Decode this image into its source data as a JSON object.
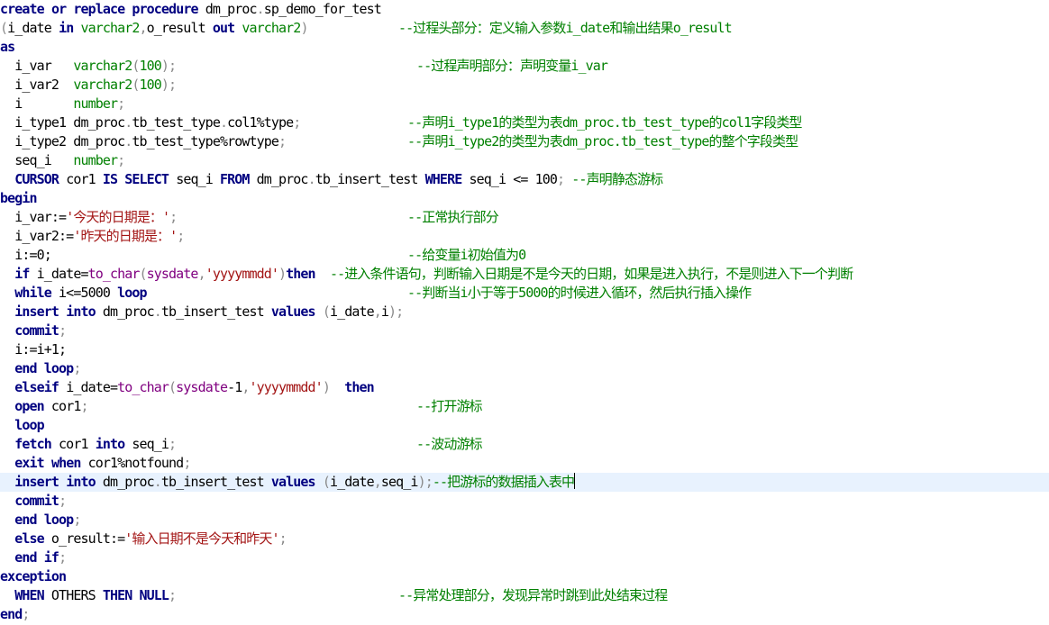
{
  "colors": {
    "keyword": "#000080",
    "type": "#008000",
    "string": "#a31515",
    "comment": "#008000",
    "punct": "#8a8a8a",
    "function": "#800080",
    "identifier": "#000000",
    "current_line": "#e8f2fe"
  },
  "editor": {
    "lines": [
      {
        "segs": [
          [
            "kw",
            "create"
          ],
          [
            "id",
            " "
          ],
          [
            "kw",
            "or"
          ],
          [
            "id",
            " "
          ],
          [
            "kw",
            "replace"
          ],
          [
            "id",
            " "
          ],
          [
            "kw",
            "procedure"
          ],
          [
            "id",
            " dm_proc"
          ],
          [
            "p",
            "."
          ],
          [
            "id",
            "sp_demo_for_test"
          ]
        ]
      },
      {
        "segs": [
          [
            "p",
            "("
          ],
          [
            "id",
            "i_date "
          ],
          [
            "kw",
            "in"
          ],
          [
            "id",
            " "
          ],
          [
            "ty",
            "varchar2"
          ],
          [
            "p",
            ","
          ],
          [
            "id",
            "o_result "
          ],
          [
            "kw",
            "out"
          ],
          [
            "id",
            " "
          ],
          [
            "ty",
            "varchar2"
          ],
          [
            "p",
            ")"
          ]
        ],
        "comment": "--过程头部分：定义输入参数i_date和输出结果o_result"
      },
      {
        "segs": [
          [
            "kw",
            "as"
          ]
        ]
      },
      {
        "segs": [
          [
            "id",
            "  i_var   "
          ],
          [
            "ty",
            "varchar2"
          ],
          [
            "p",
            "("
          ],
          [
            "ty",
            "100"
          ],
          [
            "p",
            ");"
          ]
        ],
        "comment": "--过程声明部分：声明变量i_var"
      },
      {
        "segs": [
          [
            "id",
            "  i_var2  "
          ],
          [
            "ty",
            "varchar2"
          ],
          [
            "p",
            "("
          ],
          [
            "ty",
            "100"
          ],
          [
            "p",
            ");"
          ]
        ]
      },
      {
        "segs": [
          [
            "id",
            "  i       "
          ],
          [
            "ty",
            "number"
          ],
          [
            "p",
            ";"
          ]
        ]
      },
      {
        "segs": [
          [
            "id",
            "  i_type1 dm_proc"
          ],
          [
            "p",
            "."
          ],
          [
            "id",
            "tb_test_type"
          ],
          [
            "p",
            "."
          ],
          [
            "id",
            "col1%type"
          ],
          [
            "p",
            ";"
          ]
        ],
        "comment": "--声明i_type1的类型为表dm_proc.tb_test_type的col1字段类型"
      },
      {
        "segs": [
          [
            "id",
            "  i_type2 dm_proc"
          ],
          [
            "p",
            "."
          ],
          [
            "id",
            "tb_test_type%rowtype"
          ],
          [
            "p",
            ";"
          ]
        ],
        "comment": "--声明i_type2的类型为表dm_proc.tb_test_type的整个字段类型"
      },
      {
        "segs": [
          [
            "id",
            "  seq_i   "
          ],
          [
            "ty",
            "number"
          ],
          [
            "p",
            ";"
          ]
        ]
      },
      {
        "segs": [
          [
            "id",
            "  "
          ],
          [
            "kw",
            "CURSOR"
          ],
          [
            "id",
            " cor1 "
          ],
          [
            "kw",
            "IS"
          ],
          [
            "id",
            " "
          ],
          [
            "kw",
            "SELECT"
          ],
          [
            "id",
            " seq_i "
          ],
          [
            "kw",
            "FROM"
          ],
          [
            "id",
            " dm_proc"
          ],
          [
            "p",
            "."
          ],
          [
            "id",
            "tb_insert_test "
          ],
          [
            "kw",
            "WHERE"
          ],
          [
            "id",
            " seq_i <= 100"
          ],
          [
            "p",
            ";"
          ],
          [
            "cm",
            " --声明静态游标"
          ]
        ]
      },
      {
        "segs": [
          [
            "kw",
            "begin"
          ]
        ]
      },
      {
        "segs": [
          [
            "id",
            "  i_var:="
          ],
          [
            "st",
            "'今天的日期是：'"
          ],
          [
            "p",
            ";"
          ]
        ],
        "comment": "--正常执行部分"
      },
      {
        "segs": [
          [
            "id",
            "  i_var2:="
          ],
          [
            "st",
            "'昨天的日期是：'"
          ],
          [
            "p",
            ";"
          ]
        ]
      },
      {
        "segs": [
          [
            "id",
            "  i:=0;"
          ]
        ],
        "comment": "--给变量i初始值为0"
      },
      {
        "segs": [
          [
            "id",
            "  "
          ],
          [
            "kw",
            "if"
          ],
          [
            "id",
            " i_date="
          ],
          [
            "fn",
            "to_char"
          ],
          [
            "p",
            "("
          ],
          [
            "fn",
            "sysdate"
          ],
          [
            "p",
            ","
          ],
          [
            "st",
            "'yyyymmdd'"
          ],
          [
            "p",
            ")"
          ],
          [
            "kw",
            "then"
          ],
          [
            "cm",
            "  --进入条件语句，判断输入日期是不是今天的日期，如果是进入执行，不是则进入下一个判断"
          ]
        ]
      },
      {
        "segs": [
          [
            "id",
            "  "
          ],
          [
            "kw",
            "while"
          ],
          [
            "id",
            " i<=5000 "
          ],
          [
            "kw",
            "loop"
          ]
        ],
        "comment": "--判断当i小于等于5000的时候进入循环，然后执行插入操作"
      },
      {
        "segs": [
          [
            "id",
            "  "
          ],
          [
            "kw",
            "insert"
          ],
          [
            "id",
            " "
          ],
          [
            "kw",
            "into"
          ],
          [
            "id",
            " dm_proc"
          ],
          [
            "p",
            "."
          ],
          [
            "id",
            "tb_insert_test "
          ],
          [
            "kw",
            "values"
          ],
          [
            "id",
            " "
          ],
          [
            "p",
            "("
          ],
          [
            "id",
            "i_date"
          ],
          [
            "p",
            ","
          ],
          [
            "id",
            "i"
          ],
          [
            "p",
            ");"
          ]
        ]
      },
      {
        "segs": [
          [
            "id",
            "  "
          ],
          [
            "kw",
            "commit"
          ],
          [
            "p",
            ";"
          ]
        ]
      },
      {
        "segs": [
          [
            "id",
            "  i:=i+1;"
          ]
        ]
      },
      {
        "segs": [
          [
            "id",
            "  "
          ],
          [
            "kw",
            "end loop"
          ],
          [
            "p",
            ";"
          ]
        ]
      },
      {
        "segs": [
          [
            "id",
            "  "
          ],
          [
            "kw",
            "elseif"
          ],
          [
            "id",
            " i_date="
          ],
          [
            "fn",
            "to_char"
          ],
          [
            "p",
            "("
          ],
          [
            "fn",
            "sysdate"
          ],
          [
            "id",
            "-1"
          ],
          [
            "p",
            ","
          ],
          [
            "st",
            "'yyyymmdd'"
          ],
          [
            "p",
            ")"
          ],
          [
            "id",
            "  "
          ],
          [
            "kw",
            "then"
          ]
        ]
      },
      {
        "segs": [
          [
            "id",
            "  "
          ],
          [
            "kw",
            "open"
          ],
          [
            "id",
            " cor1"
          ],
          [
            "p",
            ";"
          ]
        ],
        "comment": "--打开游标",
        "commentCol": 46
      },
      {
        "segs": [
          [
            "id",
            "  "
          ],
          [
            "kw",
            "loop"
          ]
        ]
      },
      {
        "segs": [
          [
            "id",
            "  "
          ],
          [
            "kw",
            "fetch"
          ],
          [
            "id",
            " cor1 "
          ],
          [
            "kw",
            "into"
          ],
          [
            "id",
            " seq_i"
          ],
          [
            "p",
            ";"
          ]
        ],
        "comment": "--波动游标",
        "commentCol": 46
      },
      {
        "segs": [
          [
            "id",
            "  "
          ],
          [
            "kw",
            "exit"
          ],
          [
            "id",
            " "
          ],
          [
            "kw",
            "when"
          ],
          [
            "id",
            " cor1%notfound"
          ],
          [
            "p",
            ";"
          ]
        ]
      },
      {
        "segs": [
          [
            "id",
            "  "
          ],
          [
            "kw",
            "insert"
          ],
          [
            "id",
            " "
          ],
          [
            "kw",
            "into"
          ],
          [
            "id",
            " dm_proc"
          ],
          [
            "p",
            "."
          ],
          [
            "id",
            "tb_insert_test "
          ],
          [
            "kw",
            "values"
          ],
          [
            "id",
            " "
          ],
          [
            "p",
            "("
          ],
          [
            "id",
            "i_date"
          ],
          [
            "p",
            ","
          ],
          [
            "id",
            "seq_i"
          ],
          [
            "p",
            ");"
          ],
          [
            "cm",
            "--把游标的数据插入表中"
          ]
        ],
        "current": true
      },
      {
        "segs": [
          [
            "id",
            "  "
          ],
          [
            "kw",
            "commit"
          ],
          [
            "p",
            ";"
          ]
        ]
      },
      {
        "segs": [
          [
            "id",
            "  "
          ],
          [
            "kw",
            "end loop"
          ],
          [
            "p",
            ";"
          ]
        ]
      },
      {
        "segs": [
          [
            "id",
            "  "
          ],
          [
            "kw",
            "else"
          ],
          [
            "id",
            " o_result:="
          ],
          [
            "st",
            "'输入日期不是今天和昨天'"
          ],
          [
            "p",
            ";"
          ]
        ]
      },
      {
        "segs": [
          [
            "id",
            "  "
          ],
          [
            "kw",
            "end if"
          ],
          [
            "p",
            ";"
          ]
        ]
      },
      {
        "segs": [
          [
            "kw",
            "exception"
          ]
        ]
      },
      {
        "segs": [
          [
            "id",
            "  "
          ],
          [
            "kw",
            "WHEN"
          ],
          [
            "id",
            " OTHERS "
          ],
          [
            "kw",
            "THEN"
          ],
          [
            "id",
            " "
          ],
          [
            "kw",
            "NULL"
          ],
          [
            "p",
            ";"
          ]
        ],
        "comment": "--异常处理部分，发现异常时跳到此处结束过程",
        "commentCol": 44
      },
      {
        "segs": [
          [
            "kw",
            "end"
          ],
          [
            "p",
            ";"
          ]
        ]
      }
    ]
  }
}
